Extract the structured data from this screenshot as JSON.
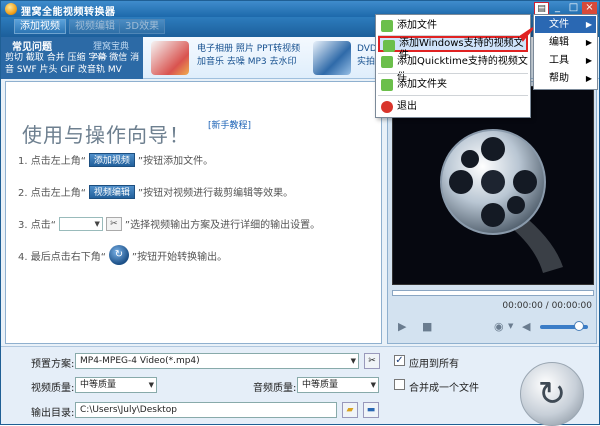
{
  "app": {
    "title": "狸窝全能视频转换器"
  },
  "window": {
    "menu_icon": "▤",
    "minimize": "_",
    "maximize": "□",
    "close": "×"
  },
  "toolbar": {
    "add_video": "添加视频",
    "edit_video": "视频编辑",
    "effects": "3D效果"
  },
  "faq": {
    "title": "常见问题",
    "more": "狸窝宝典>>",
    "links": "剪切 截取 合并 压缩 字幕 微信 消音 SWF 片头 GIF 改音轨 MV"
  },
  "ads": {
    "line1": "电子相册 照片 PPT转视频",
    "line2": "加音乐 去噪 MP3 去水印",
    "line3": "DVD",
    "line4": "实拍"
  },
  "guide": {
    "title": "使用与操作向导！",
    "link": "[新手教程]",
    "step1_pre": "1. 点击左上角“",
    "step1_btn": "添加视频",
    "step1_post": "”按钮添加文件。",
    "step2_pre": "2. 点击左上角“",
    "step2_btn": "视频编辑",
    "step2_post": "”按钮对视频进行裁剪编辑等效果。",
    "step3_pre": "3. 点击“",
    "step3_post": "”选择视频输出方案及进行详细的输出设置。",
    "step4_pre": "4. 最后点击右下角“",
    "step4_post": "”按钮开始转换输出。"
  },
  "player": {
    "time": "00:00:00 / 00:00:00"
  },
  "settings": {
    "preset_label": "预置方案:",
    "preset_value": "MP4-MPEG-4 Video(*.mp4)",
    "apply_all": "应用到所有",
    "video_quality_label": "视频质量:",
    "video_quality": "中等质量",
    "audio_quality_label": "音频质量:",
    "audio_quality": "中等质量",
    "merge": "合并成一个文件",
    "output_label": "输出目录:",
    "output_path": "C:\\Users\\July\\Desktop"
  },
  "file_menu": {
    "add_file": "添加文件",
    "add_windows": "添加Windows支持的视频文件",
    "add_quicktime": "添加Quicktime支持的视频文件",
    "add_folder": "添加文件夹",
    "exit": "退出"
  },
  "main_menu": {
    "file": "文件",
    "edit": "编辑",
    "tools": "工具",
    "help": "帮助"
  },
  "colors": {
    "accent": "#2a68b3",
    "highlight_border": "#e02222",
    "titlebar": "#1d69ab"
  }
}
